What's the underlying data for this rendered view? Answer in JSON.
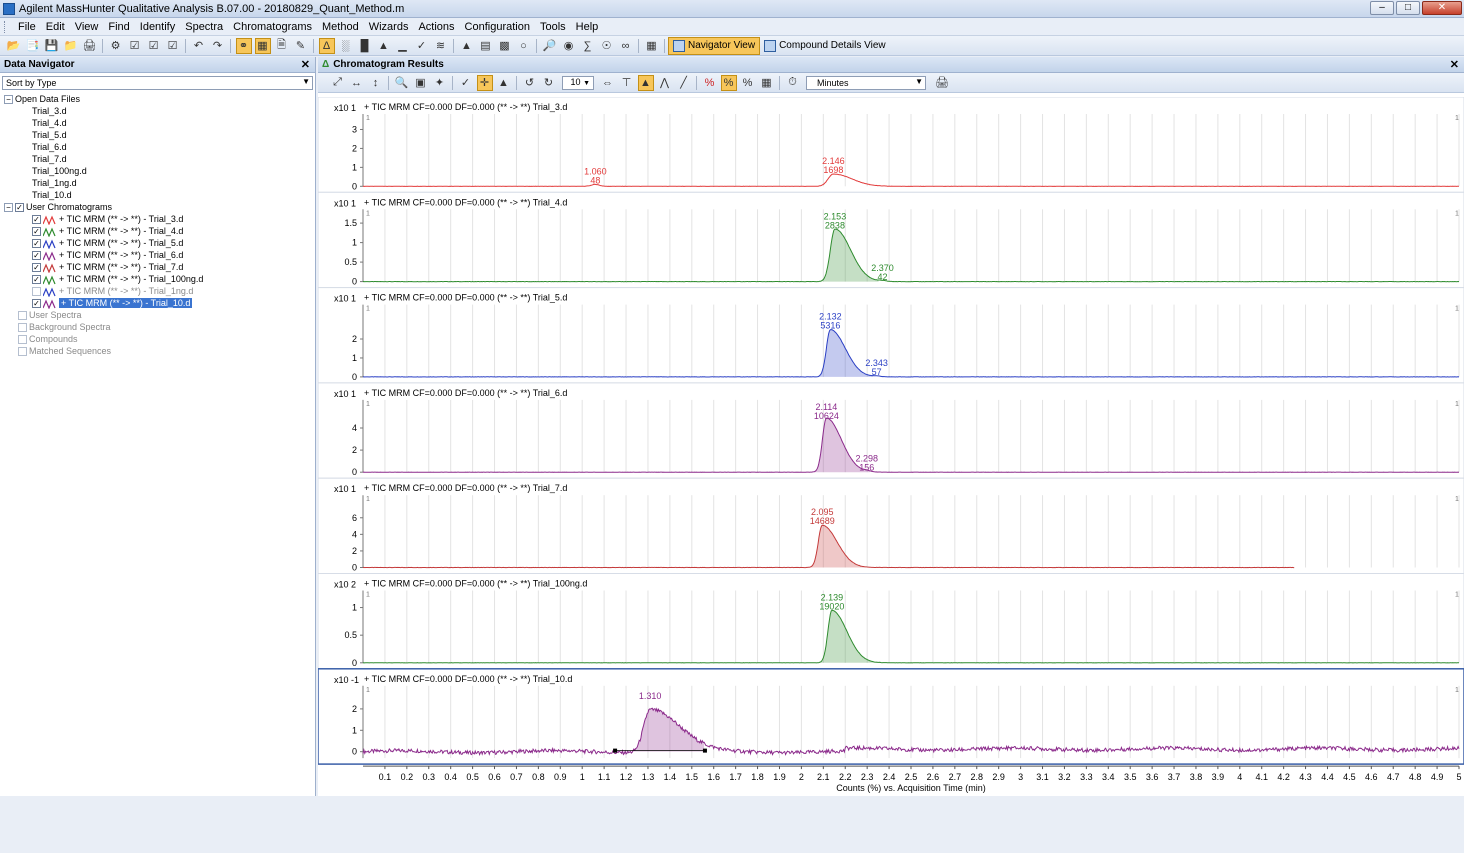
{
  "window": {
    "title": "Agilent MassHunter Qualitative Analysis B.07.00 - 20180829_Quant_Method.m"
  },
  "menu": [
    "File",
    "Edit",
    "View",
    "Find",
    "Identify",
    "Spectra",
    "Chromatograms",
    "Method",
    "Wizards",
    "Actions",
    "Configuration",
    "Tools",
    "Help"
  ],
  "toolbar": {
    "navigator_view": "Navigator View",
    "compound_details_view": "Compound Details View"
  },
  "navigator": {
    "title": "Data Navigator",
    "sort_value": "Sort by Type",
    "open_data_files_label": "Open Data Files",
    "files": [
      "Trial_3.d",
      "Trial_4.d",
      "Trial_5.d",
      "Trial_6.d",
      "Trial_7.d",
      "Trial_100ng.d",
      "Trial_1ng.d",
      "Trial_10.d"
    ],
    "user_chromatograms_label": "User Chromatograms",
    "chromatograms": [
      {
        "label": "+ TIC MRM (** -> **) - Trial_3.d",
        "checked": true,
        "color": "#e23a3a"
      },
      {
        "label": "+ TIC MRM (** -> **) - Trial_4.d",
        "checked": true,
        "color": "#2e8b2e"
      },
      {
        "label": "+ TIC MRM (** -> **) - Trial_5.d",
        "checked": true,
        "color": "#2a3fc4"
      },
      {
        "label": "+ TIC MRM (** -> **) - Trial_6.d",
        "checked": true,
        "color": "#8b2a8b"
      },
      {
        "label": "+ TIC MRM (** -> **) - Trial_7.d",
        "checked": true,
        "color": "#c43a3a"
      },
      {
        "label": "+ TIC MRM (** -> **) - Trial_100ng.d",
        "checked": true,
        "color": "#2e8b2e"
      },
      {
        "label": "+ TIC MRM (** -> **) - Trial_1ng.d",
        "checked": false,
        "color": "#2a3fc4"
      },
      {
        "label": "+ TIC MRM (** -> **) - Trial_10.d",
        "checked": true,
        "color": "#8b2a8b",
        "selected": true
      }
    ],
    "other_nodes": [
      "User Spectra",
      "Background Spectra",
      "Compounds",
      "Matched Sequences"
    ]
  },
  "results": {
    "title": "Chromatogram Results",
    "count_value": "10",
    "units_value": "Minutes"
  },
  "chart_data": {
    "type": "line",
    "xlabel": "Counts (%) vs. Acquisition Time (min)",
    "xlim": [
      0,
      5
    ],
    "x_ticks": [
      "0.1",
      "0.2",
      "0.3",
      "0.4",
      "0.5",
      "0.6",
      "0.7",
      "0.8",
      "0.9",
      "1",
      "1.1",
      "1.2",
      "1.3",
      "1.4",
      "1.5",
      "1.6",
      "1.7",
      "1.8",
      "1.9",
      "2",
      "2.1",
      "2.2",
      "2.3",
      "2.4",
      "2.5",
      "2.6",
      "2.7",
      "2.8",
      "2.9",
      "3",
      "3.1",
      "3.2",
      "3.3",
      "3.4",
      "3.5",
      "3.6",
      "3.7",
      "3.8",
      "3.9",
      "4",
      "4.1",
      "4.2",
      "4.3",
      "4.4",
      "4.5",
      "4.6",
      "4.7",
      "4.8",
      "4.9",
      "5"
    ],
    "panels": [
      {
        "title": "+ TIC MRM CF=0.000 DF=0.000 (** -> **) Trial_3.d",
        "scale": "x10 1",
        "color": "#e23a3a",
        "fill": false,
        "ylim": [
          0,
          3.5
        ],
        "yticks": [
          "0",
          "1",
          "2",
          "3"
        ],
        "peaks": [
          {
            "rt": 1.06,
            "h": 0.1,
            "w": 0.03,
            "tail": 0
          },
          {
            "rt": 2.146,
            "h": 0.65,
            "w": 0.04,
            "tail": 0.06
          }
        ],
        "labels": [
          {
            "rt": 1.06,
            "time": "1.060",
            "area": "48"
          },
          {
            "rt": 2.146,
            "time": "2.146",
            "area": "1698"
          }
        ]
      },
      {
        "title": "+ TIC MRM CF=0.000 DF=0.000 (** -> **) Trial_4.d",
        "scale": "x10 1",
        "color": "#2e8b2e",
        "fill": true,
        "ylim": [
          0,
          1.7
        ],
        "yticks": [
          "0",
          "0.5",
          "1",
          "1.5"
        ],
        "peaks": [
          {
            "rt": 2.153,
            "h": 1.35,
            "w": 0.035,
            "tail": 0.05
          },
          {
            "rt": 2.37,
            "h": 0.02,
            "w": 0.03,
            "tail": 0
          }
        ],
        "labels": [
          {
            "rt": 2.153,
            "time": "2.153",
            "area": "2838"
          },
          {
            "rt": 2.37,
            "time": "2.370",
            "area": "42"
          }
        ]
      },
      {
        "title": "+ TIC MRM CF=0.000 DF=0.000 (** -> **) Trial_5.d",
        "scale": "x10 1",
        "color": "#2a3fc4",
        "fill": true,
        "ylim": [
          0,
          3.5
        ],
        "yticks": [
          "0",
          "1",
          "2"
        ],
        "peaks": [
          {
            "rt": 2.132,
            "h": 2.5,
            "w": 0.03,
            "tail": 0.05
          },
          {
            "rt": 2.343,
            "h": 0.04,
            "w": 0.03,
            "tail": 0
          }
        ],
        "labels": [
          {
            "rt": 2.132,
            "time": "2.132",
            "area": "5316"
          },
          {
            "rt": 2.343,
            "time": "2.343",
            "area": "57"
          }
        ]
      },
      {
        "title": "+ TIC MRM CF=0.000 DF=0.000 (** -> **) Trial_6.d",
        "scale": "x10 1",
        "color": "#8b2a8b",
        "fill": true,
        "ylim": [
          0,
          6
        ],
        "yticks": [
          "0",
          "2",
          "4"
        ],
        "peaks": [
          {
            "rt": 2.114,
            "h": 4.9,
            "w": 0.03,
            "tail": 0.05
          },
          {
            "rt": 2.298,
            "h": 0.08,
            "w": 0.03,
            "tail": 0
          }
        ],
        "labels": [
          {
            "rt": 2.114,
            "time": "2.114",
            "area": "10624"
          },
          {
            "rt": 2.298,
            "time": "2.298",
            "area": "156"
          }
        ]
      },
      {
        "title": "+ TIC MRM CF=0.000 DF=0.000 (** -> **) Trial_7.d",
        "scale": "x10 1",
        "color": "#c43a3a",
        "fill": true,
        "end_rt": 4.25,
        "ylim": [
          0,
          8
        ],
        "yticks": [
          "0",
          "2",
          "4",
          "6"
        ],
        "peaks": [
          {
            "rt": 2.095,
            "h": 5.1,
            "w": 0.03,
            "tail": 0.05
          }
        ],
        "labels": [
          {
            "rt": 2.095,
            "time": "2.095",
            "area": "14689"
          }
        ]
      },
      {
        "title": "+ TIC MRM CF=0.000 DF=0.000 (** -> **) Trial_100ng.d",
        "scale": "x10 2",
        "color": "#2e8b2e",
        "fill": true,
        "ylim": [
          0,
          1.2
        ],
        "yticks": [
          "0",
          "0.5",
          "1"
        ],
        "peaks": [
          {
            "rt": 2.139,
            "h": 0.95,
            "w": 0.03,
            "tail": 0.05
          }
        ],
        "labels": [
          {
            "rt": 2.139,
            "time": "2.139",
            "area": "19020"
          }
        ]
      },
      {
        "title": "+ TIC MRM CF=0.000 DF=0.000 (** -> **) Trial_10.d",
        "scale": "x10 -1",
        "color": "#8b2a8b",
        "fill": true,
        "noisy": true,
        "selected": true,
        "ylim": [
          -0.3,
          2.8
        ],
        "yticks": [
          "0",
          "1",
          "2"
        ],
        "peaks": [
          {
            "rt": 1.31,
            "h": 2.0,
            "w": 0.05,
            "tail": 0.1
          }
        ],
        "labels": [
          {
            "rt": 1.31,
            "time": "1.310",
            "area": ""
          }
        ],
        "integration": [
          1.15,
          1.56
        ]
      }
    ]
  }
}
